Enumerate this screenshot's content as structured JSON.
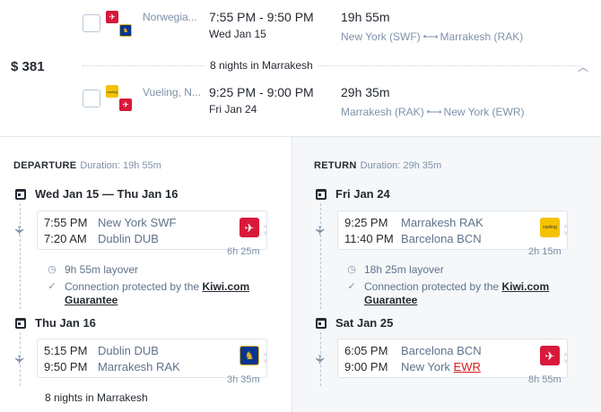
{
  "summary": {
    "price": "$ 381",
    "outbound": {
      "carrier": "Norwegia...",
      "times": "7:55 PM - 9:50 PM",
      "date": "Wed Jan 15",
      "duration": "19h 55m",
      "from": "New York (SWF)",
      "to": "Marrakesh (RAK)"
    },
    "nights": "8 nights in Marrakesh",
    "inbound": {
      "carrier": "Vueling, N...",
      "times": "9:25 PM - 9:00 PM",
      "date": "Fri Jan 24",
      "duration": "29h 35m",
      "from": "Marrakesh (RAK)",
      "to": "New York (EWR)"
    }
  },
  "departure": {
    "label": "DEPARTURE",
    "duration": "Duration: 19h 55m",
    "day1": "Wed Jan 15 — Thu Jan 16",
    "seg1": {
      "t1": "7:55 PM",
      "p1": "New York SWF",
      "t2": "7:20 AM",
      "p2": "Dublin DUB",
      "dur": "6h 25m",
      "carrier_icon": "norwegian-logo"
    },
    "layover": "9h 55m layover",
    "protect_text": "Connection protected by the",
    "protect_link1": "Kiwi.com",
    "protect_link2": "Guarantee",
    "day2": "Thu Jan 16",
    "seg2": {
      "t1": "5:15 PM",
      "p1": "Dublin DUB",
      "t2": "9:50 PM",
      "p2": "Marrakesh RAK",
      "dur": "3h 35m",
      "carrier_icon": "ryanair-logo"
    },
    "nights": "8 nights in Marrakesh"
  },
  "return": {
    "label": "RETURN",
    "duration": "Duration: 29h 35m",
    "day1": "Fri Jan 24",
    "seg1": {
      "t1": "9:25 PM",
      "p1": "Marrakesh RAK",
      "t2": "11:40 PM",
      "p2": "Barcelona BCN",
      "dur": "2h 15m",
      "carrier_icon": "vueling-logo"
    },
    "layover": "18h 25m layover",
    "protect_text": "Connection protected by the",
    "protect_link1": "Kiwi.com",
    "protect_link2": "Guarantee",
    "day2": "Sat Jan 25",
    "seg2": {
      "t1": "6:05 PM",
      "p1": "Barcelona BCN",
      "t2": "9:00 PM",
      "p2a": "New York",
      "p2b": "EWR",
      "dur": "8h 55m",
      "carrier_icon": "norwegian-logo"
    }
  },
  "colors": {
    "norwegian": "#d81939",
    "ryanair": "#073590",
    "vueling": "#f5c200",
    "warning": "#d21c1c"
  }
}
